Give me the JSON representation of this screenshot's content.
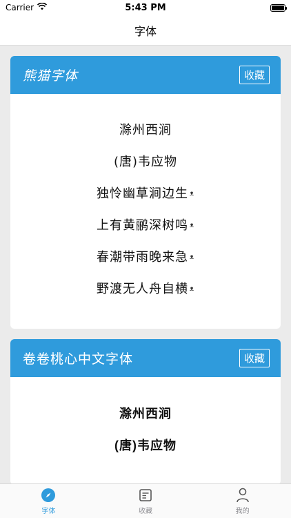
{
  "status_bar": {
    "carrier": "Carrier",
    "time": "5:43 PM"
  },
  "nav": {
    "title": "字体"
  },
  "cards": [
    {
      "title": "熊猫字体",
      "favorite_label": "收藏",
      "lines": [
        "滁州西涧",
        "(唐)韦应物",
        "独怜幽草涧边生",
        "上有黄鹂深树鸣",
        "春潮带雨晚来急",
        "野渡无人舟自横"
      ]
    },
    {
      "title": "卷卷桃心中文字体",
      "favorite_label": "收藏",
      "lines": [
        "滁州西涧",
        "(唐)韦应物"
      ]
    }
  ],
  "tabs": [
    {
      "label": "字体",
      "icon": "compass-icon",
      "active": true
    },
    {
      "label": "收藏",
      "icon": "document-icon",
      "active": false
    },
    {
      "label": "我的",
      "icon": "person-icon",
      "active": false
    }
  ],
  "colors": {
    "accent": "#2f9bdc",
    "background": "#ebebeb"
  }
}
